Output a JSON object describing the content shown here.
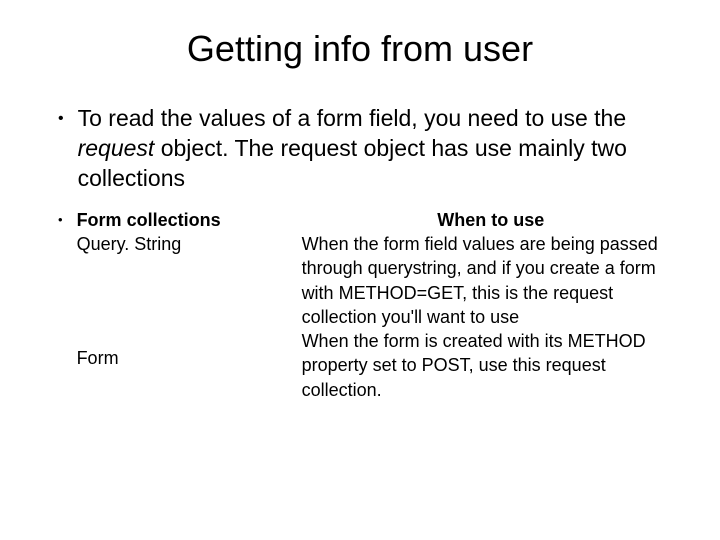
{
  "title": "Getting info from user",
  "main_bullet": {
    "prefix": "To read the values of a form field, you need to use the ",
    "italic": "request",
    "suffix": " object. The request object has use mainly two collections"
  },
  "sub": {
    "header_left": "Form collections",
    "header_right": "When to use",
    "rows": [
      {
        "name": "Query. String",
        "desc": "When the form field values are being passed through querystring, and if you create a form with METHOD=GET, this is the request collection you'll want to use"
      },
      {
        "name": "Form",
        "desc": "When the form is created with its METHOD property set to POST, use this request collection."
      }
    ]
  }
}
